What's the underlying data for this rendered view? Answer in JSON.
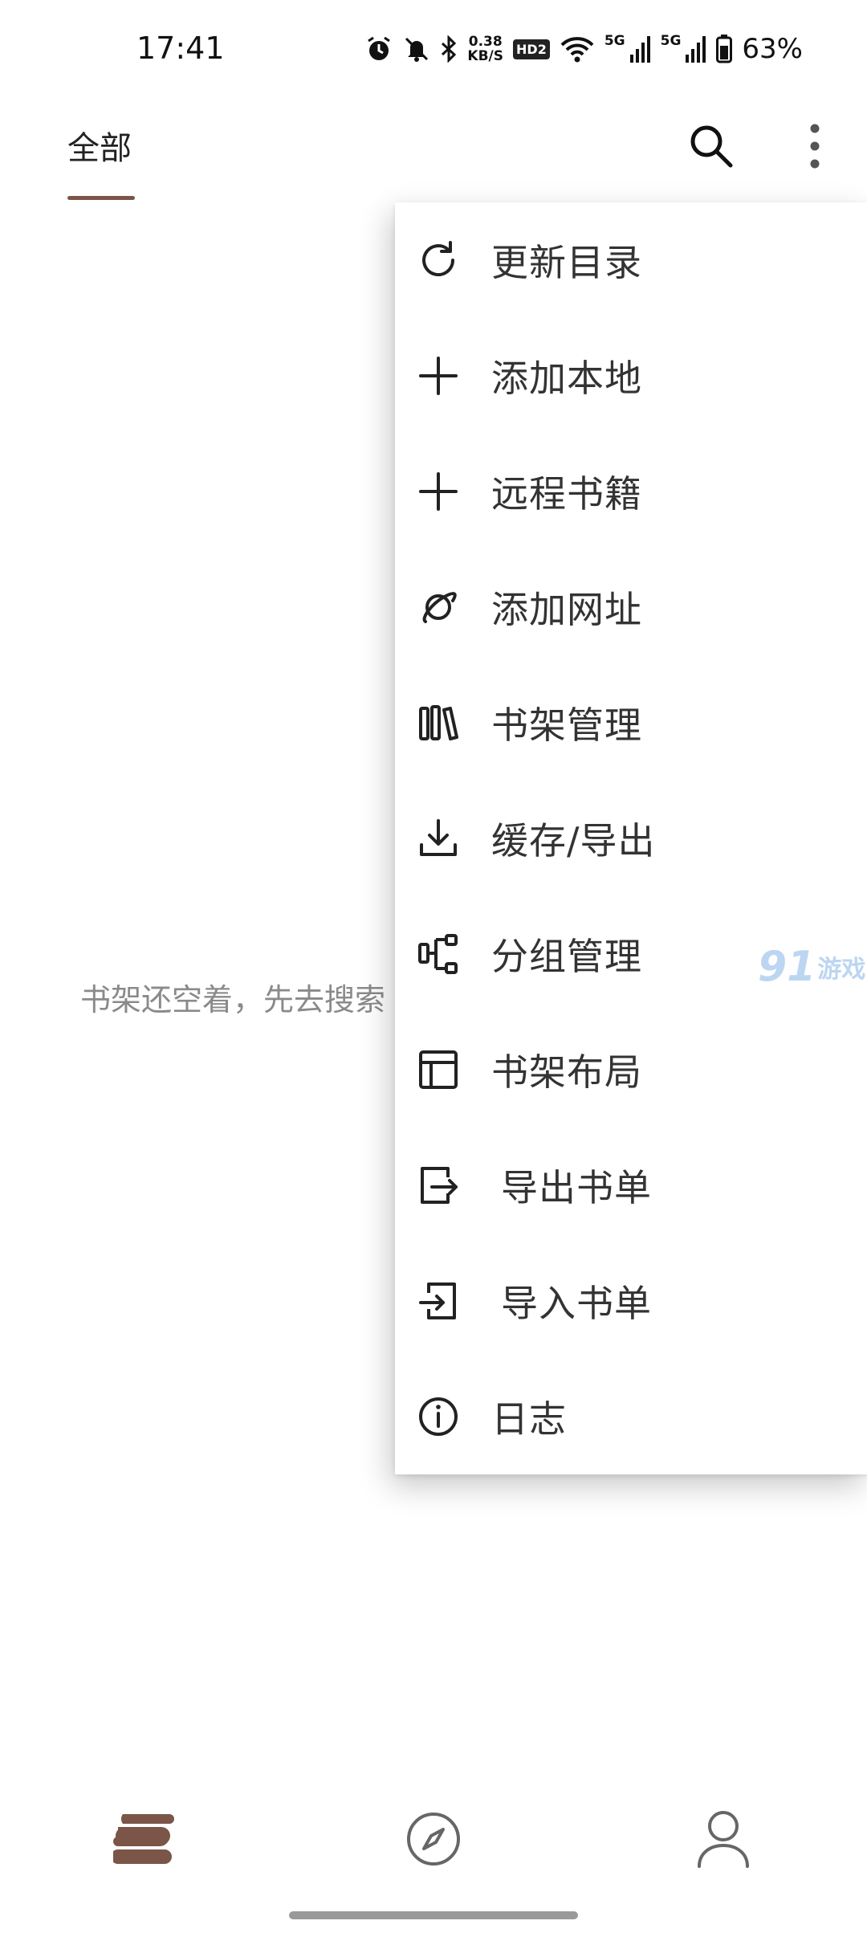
{
  "status_bar": {
    "time": "17:41",
    "net_speed_value": "0.38",
    "net_speed_unit": "KB/S",
    "hd_badge": "HD2",
    "sim1": "5G",
    "sim2": "5G",
    "battery": "63%"
  },
  "top_bar": {
    "tab_all": "全部",
    "icons": [
      "search-icon",
      "more-vert-icon"
    ]
  },
  "empty_state": {
    "message": "书架还空着，先去搜索"
  },
  "menu": {
    "items": [
      {
        "label": "更新目录",
        "icon": "refresh-icon"
      },
      {
        "label": "添加本地",
        "icon": "plus-icon"
      },
      {
        "label": "远程书籍",
        "icon": "plus-icon"
      },
      {
        "label": "添加网址",
        "icon": "planet-icon"
      },
      {
        "label": "书架管理",
        "icon": "books-icon"
      },
      {
        "label": "缓存/导出",
        "icon": "download-icon"
      },
      {
        "label": "分组管理",
        "icon": "group-icon"
      },
      {
        "label": "书架布局",
        "icon": "layout-icon"
      },
      {
        "label": "导出书单",
        "icon": "export-icon"
      },
      {
        "label": "导入书单",
        "icon": "import-icon"
      },
      {
        "label": "日志",
        "icon": "info-icon"
      }
    ]
  },
  "watermark": {
    "number": "91",
    "text": "游戏"
  },
  "bottom_nav": {
    "items": [
      "bookshelf-icon",
      "discover-compass-icon",
      "profile-icon"
    ],
    "active_color": "#7a5548"
  }
}
